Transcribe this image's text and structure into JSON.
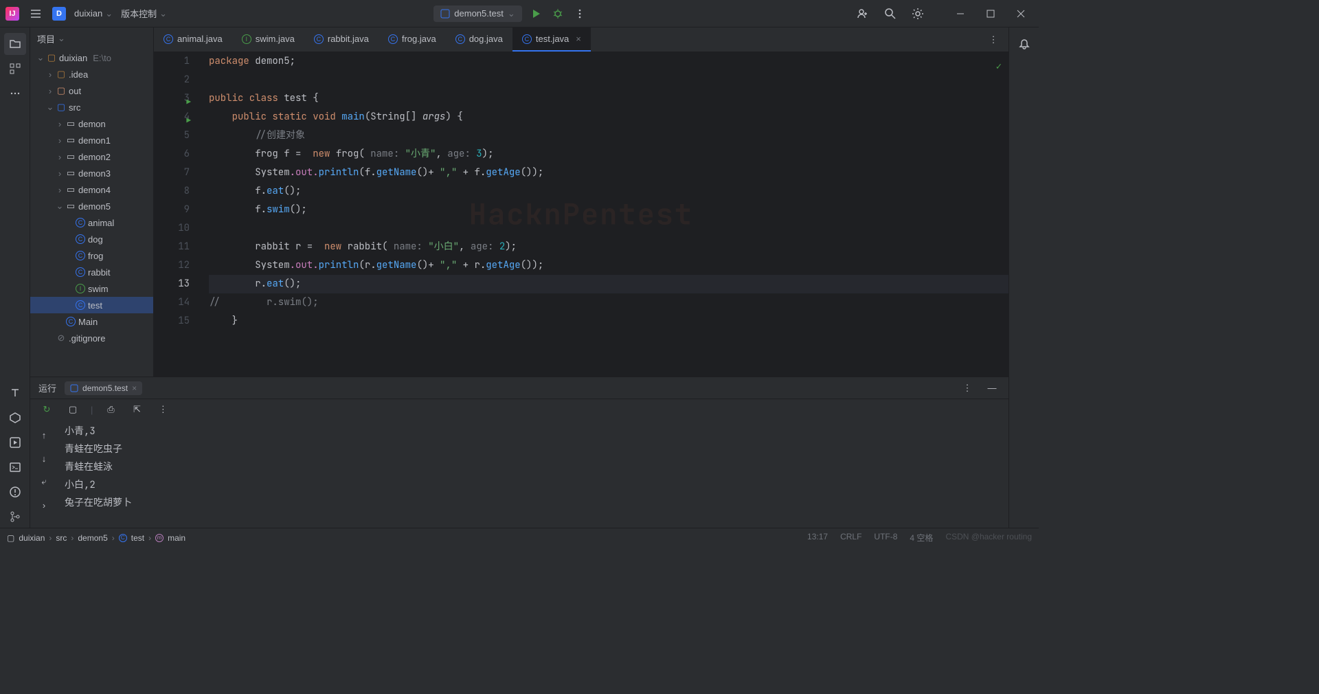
{
  "titlebar": {
    "project_letter": "D",
    "project_name": "duixian",
    "vcs_label": "版本控制",
    "run_config": "demon5.test"
  },
  "project_panel": {
    "title": "项目",
    "root": "duixian",
    "root_hint": "E:\\to",
    "idea": ".idea",
    "out": "out",
    "src": "src",
    "demon": "demon",
    "demon1": "demon1",
    "demon2": "demon2",
    "demon3": "demon3",
    "demon4": "demon4",
    "demon5": "demon5",
    "animal": "animal",
    "dog": "dog",
    "frog": "frog",
    "rabbit": "rabbit",
    "swim": "swim",
    "test": "test",
    "main": "Main",
    "gitignore": ".gitignore"
  },
  "tabs": {
    "t0": "animal.java",
    "t1": "swim.java",
    "t2": "rabbit.java",
    "t3": "frog.java",
    "t4": "dog.java",
    "t5": "test.java"
  },
  "code": {
    "l1_pkg": "package ",
    "l1_name": "demon5",
    "l3_pub": "public class ",
    "l3_cls": "test",
    "l4_pub": "public static ",
    "l4_void": "void ",
    "l4_main": "main",
    "l4_str": "String",
    "l4_args": "args",
    "l5": "//创建对象",
    "l6_type": "frog",
    "l6_new": " new ",
    "l6_ctor": "frog",
    "l6_pname": " name: ",
    "l6_pval": "\"小青\"",
    "l6_pname2": " age: ",
    "l6_pval2": "3",
    "l7_sys": "System",
    "l7_out": ".out.",
    "l7_println": "println",
    "l7_getname": "getName",
    "l7_comma": "\",\"",
    "l7_getage": "getAge",
    "l8_eat": "eat",
    "l9_swim": "swim",
    "l11_type": "rabbit",
    "l11_ctor": "rabbit",
    "l11_pval": "\"小白\"",
    "l11_pval2": "2",
    "l14_swim": "r.swim();",
    "watermark": "HacknPentest"
  },
  "gutter": {
    "n1": "1",
    "n2": "2",
    "n3": "3",
    "n4": "4",
    "n5": "5",
    "n6": "6",
    "n7": "7",
    "n8": "8",
    "n9": "9",
    "n10": "10",
    "n11": "11",
    "n12": "12",
    "n13": "13",
    "n14": "14",
    "n15": "15"
  },
  "run": {
    "label": "运行",
    "tab": "demon5.test",
    "out1": "小青,3",
    "out2": "青蛙在吃虫子",
    "out3": "青蛙在蛙泳",
    "out4": "小白,2",
    "out5": "兔子在吃胡萝卜"
  },
  "breadcrumb": {
    "b0": "duixian",
    "b1": "src",
    "b2": "demon5",
    "b3": "test",
    "b4": "main"
  },
  "status": {
    "pos": "13:17",
    "eol": "CRLF",
    "enc": "UTF-8",
    "spaces": "4 空格",
    "watermark": "CSDN @hacker routing"
  }
}
